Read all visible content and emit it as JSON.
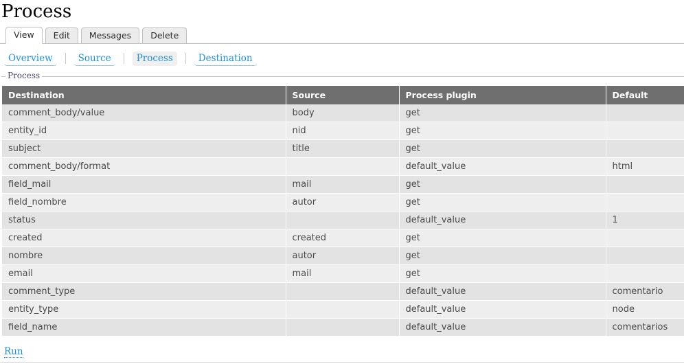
{
  "page": {
    "title": "Process"
  },
  "primary_tabs": [
    {
      "label": "View",
      "active": true
    },
    {
      "label": "Edit",
      "active": false
    },
    {
      "label": "Messages",
      "active": false
    },
    {
      "label": "Delete",
      "active": false
    }
  ],
  "secondary_tabs": [
    {
      "label": "Overview",
      "active": false
    },
    {
      "label": "Source",
      "active": false
    },
    {
      "label": "Process",
      "active": true
    },
    {
      "label": "Destination",
      "active": false
    }
  ],
  "fieldset": {
    "legend": "Process"
  },
  "table": {
    "columns": [
      "Destination",
      "Source",
      "Process plugin",
      "Default"
    ],
    "rows": [
      {
        "destination": "comment_body/value",
        "source": "body",
        "plugin": "get",
        "default": ""
      },
      {
        "destination": "entity_id",
        "source": "nid",
        "plugin": "get",
        "default": ""
      },
      {
        "destination": "subject",
        "source": "title",
        "plugin": "get",
        "default": ""
      },
      {
        "destination": "comment_body/format",
        "source": "",
        "plugin": "default_value",
        "default": "html"
      },
      {
        "destination": "field_mail",
        "source": "mail",
        "plugin": "get",
        "default": ""
      },
      {
        "destination": "field_nombre",
        "source": "autor",
        "plugin": "get",
        "default": ""
      },
      {
        "destination": "status",
        "source": "",
        "plugin": "default_value",
        "default": "1"
      },
      {
        "destination": "created",
        "source": "created",
        "plugin": "get",
        "default": ""
      },
      {
        "destination": "nombre",
        "source": "autor",
        "plugin": "get",
        "default": ""
      },
      {
        "destination": "email",
        "source": "mail",
        "plugin": "get",
        "default": ""
      },
      {
        "destination": "comment_type",
        "source": "",
        "plugin": "default_value",
        "default": "comentario"
      },
      {
        "destination": "entity_type",
        "source": "",
        "plugin": "default_value",
        "default": "node"
      },
      {
        "destination": "field_name",
        "source": "",
        "plugin": "default_value",
        "default": "comentarios"
      }
    ]
  },
  "actions": {
    "run_label": "Run"
  },
  "colors": {
    "link": "#1f8fd4",
    "table_header_bg": "#6f6f6f",
    "row_odd_bg": "#e3e3e3",
    "row_even_bg": "#eeeeee"
  }
}
